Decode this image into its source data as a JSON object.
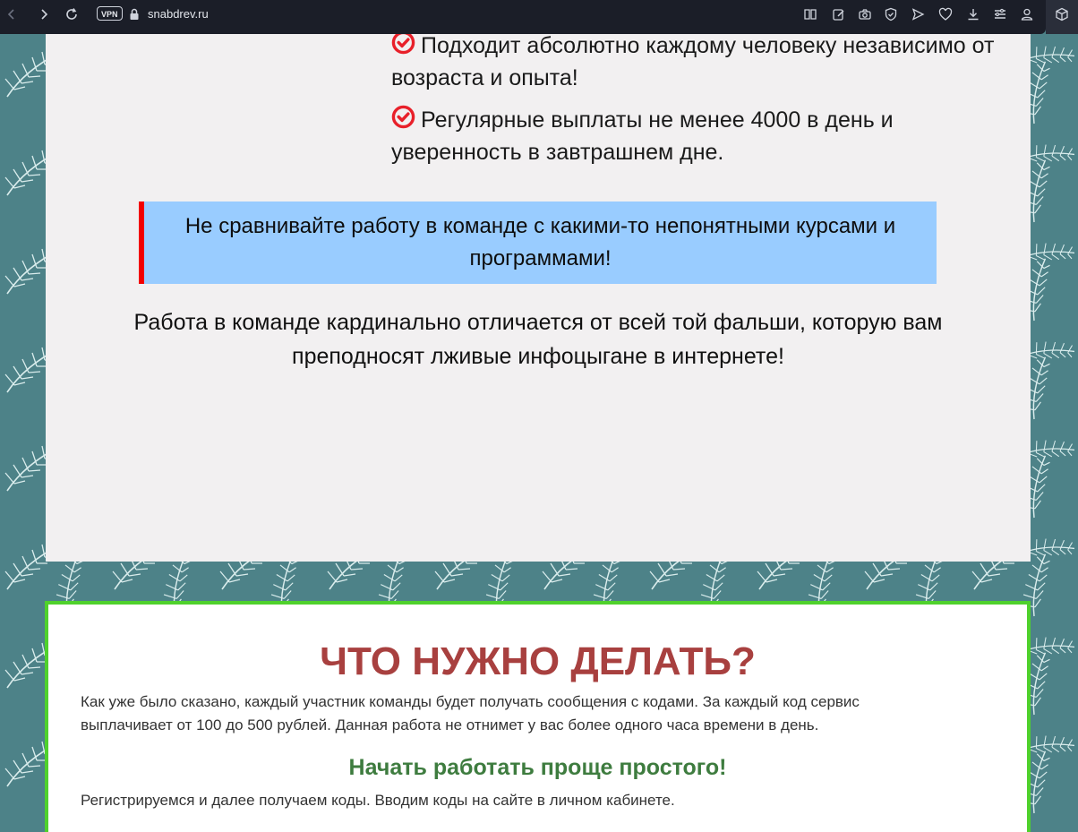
{
  "browser": {
    "url": "snabdrev.ru",
    "vpn_label": "VPN",
    "icons": [
      "back-icon",
      "forward-icon",
      "reload-icon",
      "lock-icon",
      "reader-icon",
      "edit-icon",
      "camera-icon",
      "shield-icon",
      "send-icon",
      "heart-icon",
      "download-icon",
      "menu-icon",
      "profile-icon",
      "extension-icon"
    ]
  },
  "colors": {
    "page_bg": "#4d8288",
    "card_bg": "#f2f0f1",
    "highlight_bg": "#99ccff",
    "highlight_border": "#f20000",
    "check_red": "#e8202a",
    "heading_red": "#a8403f",
    "heading_green": "#3e7c3f",
    "card2_border": "#4fd12c"
  },
  "section1": {
    "bullets": [
      {
        "icon": "check-circle-icon",
        "line1": "Подходит абсолютно каждому человеку независимо от",
        "line2": "возраста и опыта!"
      },
      {
        "icon": "check-circle-icon",
        "line1": "Регулярные выплаты не менее 4000 в день и",
        "line2": "уверенность в завтрашнем дне."
      }
    ],
    "highlight_line1": "Не сравнивайте работу в команде с какими-то непонятными курсами и",
    "highlight_line2": "программами!",
    "work_line1": "Работа в команде кардинально отличается от всей той фальши, которую вам",
    "work_line2": "преподносят лживые инфоцыгане в интернете!"
  },
  "section2": {
    "heading": "ЧТО НУЖНО ДЕЛАТЬ?",
    "intro_line1": "Как уже было сказано, каждый участник команды будет получать сообщения с кодами. За каждый код сервис",
    "intro_line2": "выплачивает от 100 до 500 рублей. Данная работа не отнимет у вас более одного часа времени в день.",
    "subheading": "Начать работать проще простого!",
    "registration_text": "Регистрируемся и далее получаем коды. Вводим коды на сайте в личном кабинете."
  }
}
